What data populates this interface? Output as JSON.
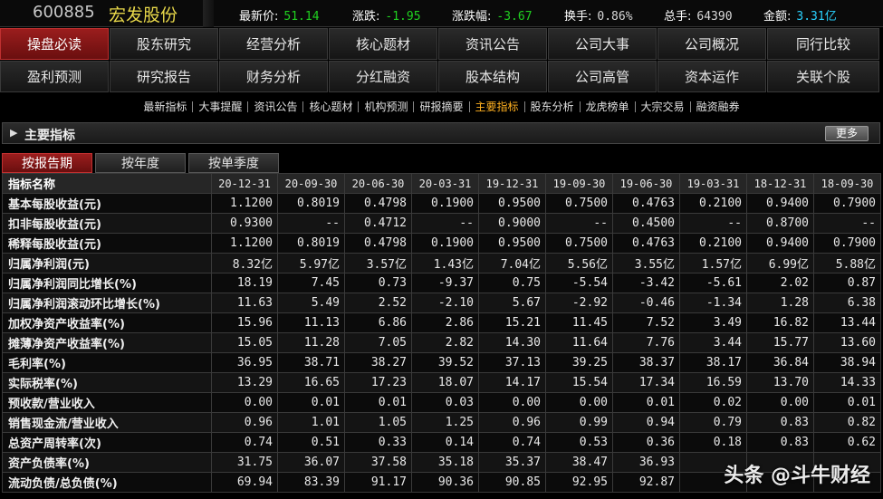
{
  "header": {
    "code": "600885",
    "name": "宏发股份",
    "quotes": [
      {
        "label": "最新价:",
        "value": "51.14",
        "color": "green"
      },
      {
        "label": "涨跌:",
        "value": "-1.95",
        "color": "green"
      },
      {
        "label": "涨跌幅:",
        "value": "-3.67",
        "color": "green"
      },
      {
        "label": "换手:",
        "value": "0.86%",
        "color": "white"
      },
      {
        "label": "总手:",
        "value": "64390",
        "color": "white"
      },
      {
        "label": "金额:",
        "value": "3.31亿",
        "color": "cyan"
      }
    ]
  },
  "nav": {
    "row1": [
      "操盘必读",
      "股东研究",
      "经营分析",
      "核心题材",
      "资讯公告",
      "公司大事",
      "公司概况",
      "同行比较"
    ],
    "row2": [
      "盈利预测",
      "研究报告",
      "财务分析",
      "分红融资",
      "股本结构",
      "公司高管",
      "资本运作",
      "关联个股"
    ],
    "active": "操盘必读"
  },
  "subnav": {
    "items": [
      "最新指标",
      "大事提醒",
      "资讯公告",
      "核心题材",
      "机构预测",
      "研报摘要",
      "主要指标",
      "股东分析",
      "龙虎榜单",
      "大宗交易",
      "融资融券"
    ],
    "active": "主要指标"
  },
  "section": {
    "title": "主要指标",
    "more": "更多"
  },
  "tabs": {
    "items": [
      "按报告期",
      "按年度",
      "按单季度"
    ],
    "active": "按报告期"
  },
  "table": {
    "header_label": "指标名称",
    "periods": [
      "20-12-31",
      "20-09-30",
      "20-06-30",
      "20-03-31",
      "19-12-31",
      "19-09-30",
      "19-06-30",
      "19-03-31",
      "18-12-31",
      "18-09-30"
    ],
    "rows": [
      {
        "name": "基本每股收益(元)",
        "values": [
          "1.1200",
          "0.8019",
          "0.4798",
          "0.1900",
          "0.9500",
          "0.7500",
          "0.4763",
          "0.2100",
          "0.9400",
          "0.7900"
        ]
      },
      {
        "name": "扣非每股收益(元)",
        "values": [
          "0.9300",
          "--",
          "0.4712",
          "--",
          "0.9000",
          "--",
          "0.4500",
          "--",
          "0.8700",
          "--"
        ]
      },
      {
        "name": "稀释每股收益(元)",
        "values": [
          "1.1200",
          "0.8019",
          "0.4798",
          "0.1900",
          "0.9500",
          "0.7500",
          "0.4763",
          "0.2100",
          "0.9400",
          "0.7900"
        ]
      },
      {
        "name": "归属净利润(元)",
        "values": [
          "8.32亿",
          "5.97亿",
          "3.57亿",
          "1.43亿",
          "7.04亿",
          "5.56亿",
          "3.55亿",
          "1.57亿",
          "6.99亿",
          "5.88亿"
        ]
      },
      {
        "name": "归属净利润同比增长(%)",
        "values": [
          "18.19",
          "7.45",
          "0.73",
          "-9.37",
          "0.75",
          "-5.54",
          "-3.42",
          "-5.61",
          "2.02",
          "0.87"
        ]
      },
      {
        "name": "归属净利润滚动环比增长(%)",
        "values": [
          "11.63",
          "5.49",
          "2.52",
          "-2.10",
          "5.67",
          "-2.92",
          "-0.46",
          "-1.34",
          "1.28",
          "6.38"
        ]
      },
      {
        "name": "加权净资产收益率(%)",
        "values": [
          "15.96",
          "11.13",
          "6.86",
          "2.86",
          "15.21",
          "11.45",
          "7.52",
          "3.49",
          "16.82",
          "13.44"
        ]
      },
      {
        "name": "摊薄净资产收益率(%)",
        "values": [
          "15.05",
          "11.28",
          "7.05",
          "2.82",
          "14.30",
          "11.64",
          "7.76",
          "3.44",
          "15.77",
          "13.60"
        ]
      },
      {
        "name": "毛利率(%)",
        "values": [
          "36.95",
          "38.71",
          "38.27",
          "39.52",
          "37.13",
          "39.25",
          "38.37",
          "38.17",
          "36.84",
          "38.94"
        ]
      },
      {
        "name": "实际税率(%)",
        "values": [
          "13.29",
          "16.65",
          "17.23",
          "18.07",
          "14.17",
          "15.54",
          "17.34",
          "16.59",
          "13.70",
          "14.33"
        ]
      },
      {
        "name": "预收款/营业收入",
        "values": [
          "0.00",
          "0.01",
          "0.01",
          "0.03",
          "0.00",
          "0.00",
          "0.01",
          "0.02",
          "0.00",
          "0.01"
        ]
      },
      {
        "name": "销售现金流/营业收入",
        "values": [
          "0.96",
          "1.01",
          "1.05",
          "1.25",
          "0.96",
          "0.99",
          "0.94",
          "0.79",
          "0.83",
          "0.82"
        ]
      },
      {
        "name": "总资产周转率(次)",
        "values": [
          "0.74",
          "0.51",
          "0.33",
          "0.14",
          "0.74",
          "0.53",
          "0.36",
          "0.18",
          "0.83",
          "0.62"
        ]
      },
      {
        "name": "资产负债率(%)",
        "values": [
          "31.75",
          "36.07",
          "37.58",
          "35.18",
          "35.37",
          "38.47",
          "36.93",
          "",
          "",
          ""
        ]
      },
      {
        "name": "流动负债/总负债(%)",
        "values": [
          "69.94",
          "83.39",
          "91.17",
          "90.36",
          "90.85",
          "92.95",
          "92.87",
          "",
          "",
          ""
        ]
      }
    ]
  },
  "watermark": "头条 @斗牛财经"
}
